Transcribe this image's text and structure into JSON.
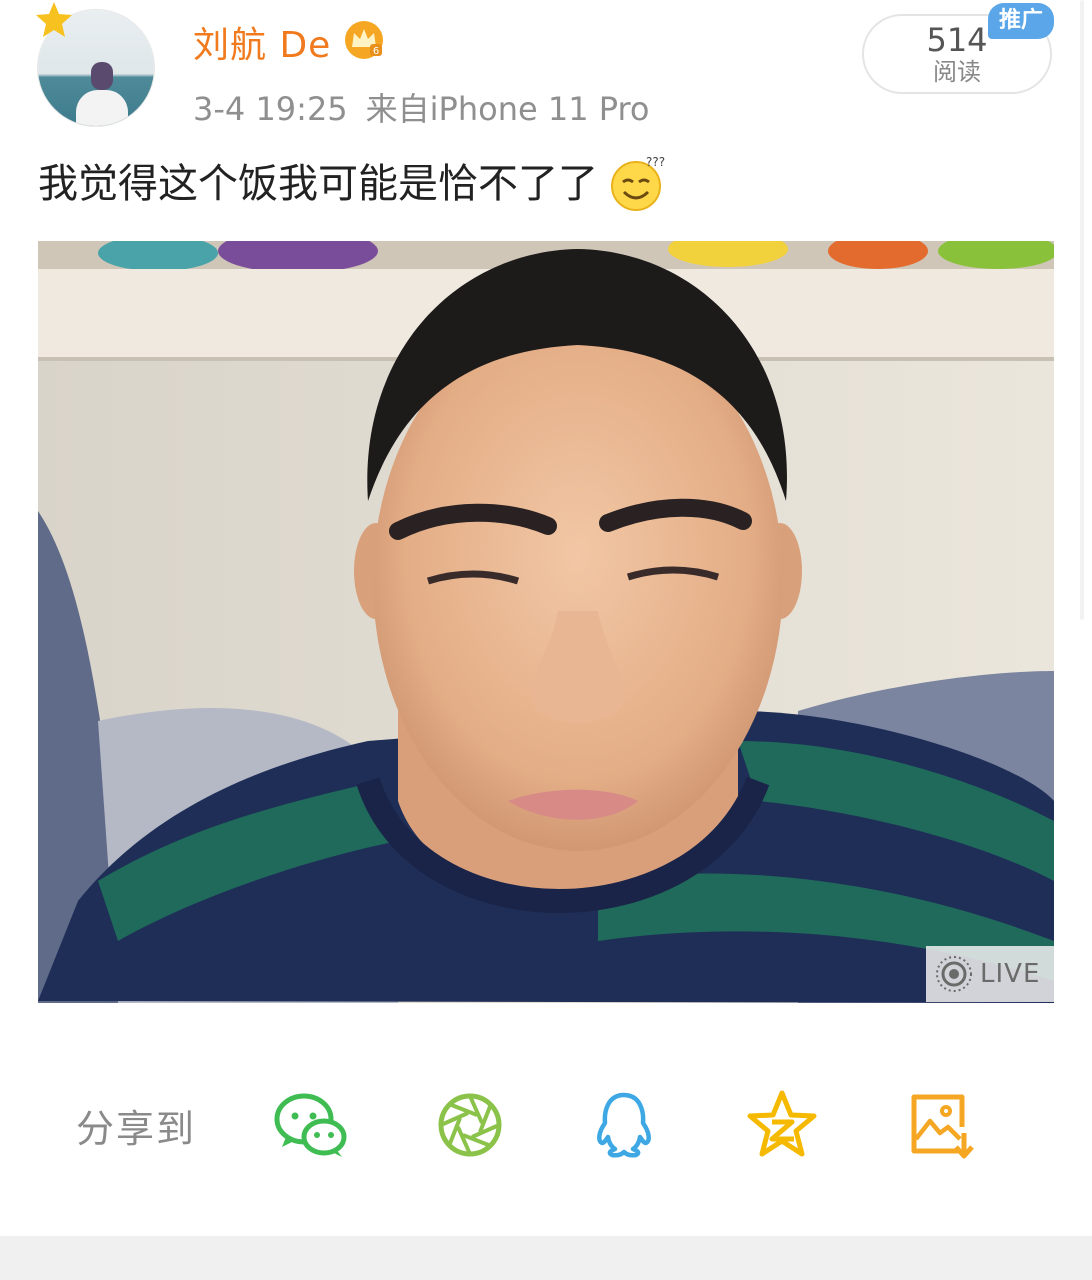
{
  "post": {
    "author": "刘航 De",
    "timestamp": "3-4 19:25",
    "source": "来自iPhone 11 Pro",
    "text": "我觉得这个饭我可能是恰不了了",
    "read_count": "514",
    "read_label": "阅读",
    "promo_badge": "推广",
    "photo_badge": "LIVE",
    "icons": {
      "vip": "star-icon",
      "membership": "crown-icon",
      "emoji": "dizzy-smile-emoji",
      "live": "live-photo-icon"
    }
  },
  "share": {
    "label": "分享到",
    "targets": [
      {
        "name": "wechat",
        "icon": "wechat-icon",
        "color": "#3fbd53"
      },
      {
        "name": "moments",
        "icon": "moments-icon",
        "color": "#8bc34a"
      },
      {
        "name": "qq",
        "icon": "qq-icon",
        "color": "#3ea8e5"
      },
      {
        "name": "qzone",
        "icon": "qzone-icon",
        "color": "#f5b900"
      },
      {
        "name": "save-image",
        "icon": "save-image-icon",
        "color": "#f5a623"
      }
    ]
  },
  "colors": {
    "author": "#f07a1d",
    "meta": "#8f8f8f",
    "promo": "#5aa6e8"
  }
}
